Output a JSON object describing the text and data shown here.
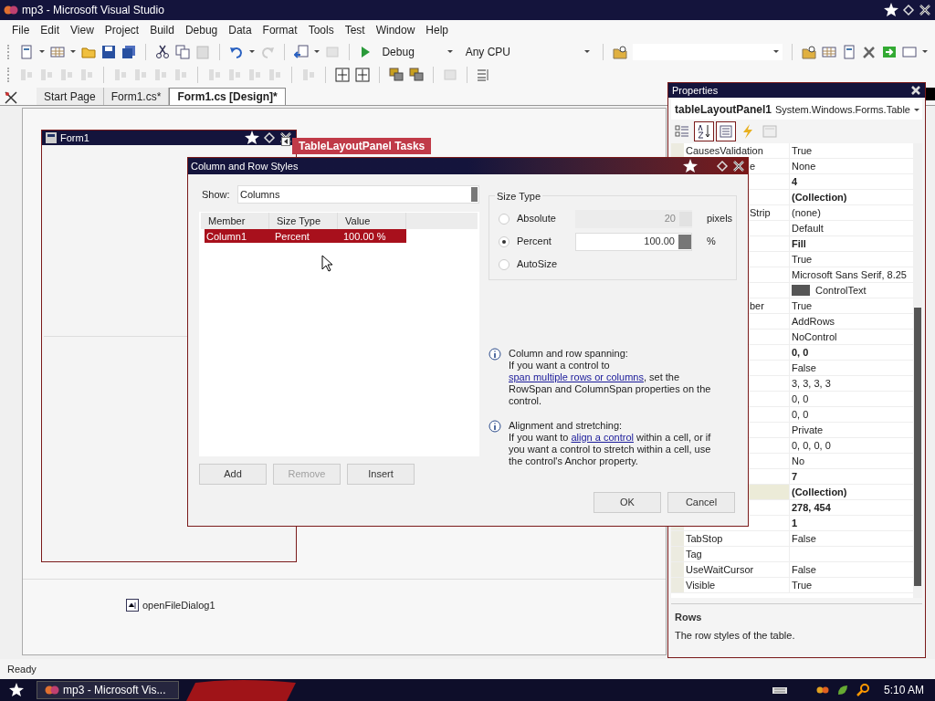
{
  "window": {
    "title": "mp3 - Microsoft Visual Studio"
  },
  "menu": [
    "File",
    "Edit",
    "View",
    "Project",
    "Build",
    "Debug",
    "Data",
    "Format",
    "Tools",
    "Test",
    "Window",
    "Help"
  ],
  "toolbar": {
    "configuration": "Debug",
    "platform": "Any CPU"
  },
  "tabs": [
    {
      "label": "Start Page",
      "selected": false
    },
    {
      "label": "Form1.cs*",
      "selected": false
    },
    {
      "label": "Form1.cs [Design]*",
      "selected": true
    }
  ],
  "designer": {
    "form_title": "Form1",
    "smart_tag": "TableLayoutPanel Tasks",
    "components": [
      "openFileDialog1"
    ]
  },
  "dialog": {
    "title": "Column and Row Styles",
    "show_label": "Show:",
    "show_value": "Columns",
    "columns": [
      "Member",
      "Size Type",
      "Value"
    ],
    "rows": [
      {
        "cells": [
          "Column1",
          "Percent",
          "100.00 %"
        ],
        "selected": true
      }
    ],
    "buttons": [
      {
        "label": "Add",
        "disabled": false
      },
      {
        "label": "Remove",
        "disabled": true
      },
      {
        "label": "Insert",
        "disabled": false
      }
    ],
    "size_type": {
      "legend": "Size Type",
      "options": [
        {
          "kind": "field",
          "label": "Absolute",
          "selected": false,
          "value": "20",
          "unit": "pixels",
          "field_disabled": true
        },
        {
          "kind": "field",
          "label": "Percent",
          "selected": true,
          "value": "100.00",
          "unit": "%",
          "field_disabled": false
        },
        {
          "kind": "plain",
          "label": "AutoSize",
          "selected": false
        }
      ]
    },
    "notes": [
      {
        "heading": "Column and row spanning:",
        "before": "If you want a control to ",
        "link": "span multiple rows or columns",
        "after": ", set the RowSpan and ColumnSpan properties on the control."
      },
      {
        "heading": "Alignment and stretching:",
        "before": "If you want to ",
        "link": "align a control",
        "after": " within a cell, or if you want a control to stretch within a cell, use the control's Anchor property."
      }
    ],
    "ok": "OK",
    "cancel": "Cancel"
  },
  "properties": {
    "title": "Properties",
    "object": "tableLayoutPanel1",
    "type": "System.Windows.Forms.Table",
    "tools": [
      {
        "kind": "categorized",
        "selected": false
      },
      {
        "kind": "alphabetical",
        "selected": true
      },
      {
        "kind": "properties",
        "selected": true
      },
      {
        "kind": "events",
        "selected": false
      },
      {
        "kind": "pages",
        "selected": false
      }
    ],
    "rows": [
      {
        "name": "CausesValidation",
        "value": "True",
        "bold": false,
        "selected": false
      },
      {
        "name": "e",
        "clipped": true,
        "value": "None",
        "bold": false,
        "selected": false
      },
      {
        "value": "4",
        "bold": true,
        "selected": false
      },
      {
        "value": "(Collection)",
        "bold": true,
        "selected": false
      },
      {
        "name": "Strip",
        "clipped": true,
        "value": "(none)",
        "bold": false,
        "selected": false
      },
      {
        "value": "Default",
        "bold": false,
        "selected": false
      },
      {
        "value": "Fill",
        "bold": true,
        "selected": false
      },
      {
        "value": "True",
        "bold": false,
        "selected": false
      },
      {
        "value": "Microsoft Sans Serif, 8.25",
        "bold": false,
        "selected": false
      },
      {
        "kind": "color",
        "color": "#555555",
        "value": "ControlText",
        "bold": false,
        "selected": false
      },
      {
        "name": "ber",
        "clipped": true,
        "value": "True",
        "bold": false,
        "selected": false
      },
      {
        "value": "AddRows",
        "bold": false,
        "selected": false
      },
      {
        "value": "NoControl",
        "bold": false,
        "selected": false
      },
      {
        "value": "0, 0",
        "bold": true,
        "selected": false
      },
      {
        "value": "False",
        "bold": false,
        "selected": false
      },
      {
        "value": "3, 3, 3, 3",
        "bold": false,
        "selected": false
      },
      {
        "value": "0, 0",
        "bold": false,
        "selected": false
      },
      {
        "value": "0, 0",
        "bold": false,
        "selected": false
      },
      {
        "value": "Private",
        "bold": false,
        "selected": false
      },
      {
        "value": "0, 0, 0, 0",
        "bold": false,
        "selected": false
      },
      {
        "value": "No",
        "bold": false,
        "selected": false
      },
      {
        "value": "7",
        "bold": true,
        "selected": false
      },
      {
        "value": "(Collection)",
        "bold": true,
        "selected": true
      },
      {
        "value": "278, 454",
        "bold": true,
        "selected": false
      },
      {
        "value": "1",
        "bold": true,
        "selected": false
      },
      {
        "name": "TabStop",
        "value": "False",
        "bold": false,
        "selected": false
      },
      {
        "name": "Tag",
        "selected": false
      },
      {
        "name": "UseWaitCursor",
        "value": "False",
        "bold": false,
        "selected": false
      },
      {
        "name": "Visible",
        "value": "True",
        "bold": false,
        "selected": false
      }
    ],
    "description": {
      "title": "Rows",
      "text": "The row styles of the table."
    }
  },
  "status_bar": "Ready",
  "taskbar": {
    "task": "mp3 - Microsoft Vis...",
    "clock": "5:10 AM"
  }
}
